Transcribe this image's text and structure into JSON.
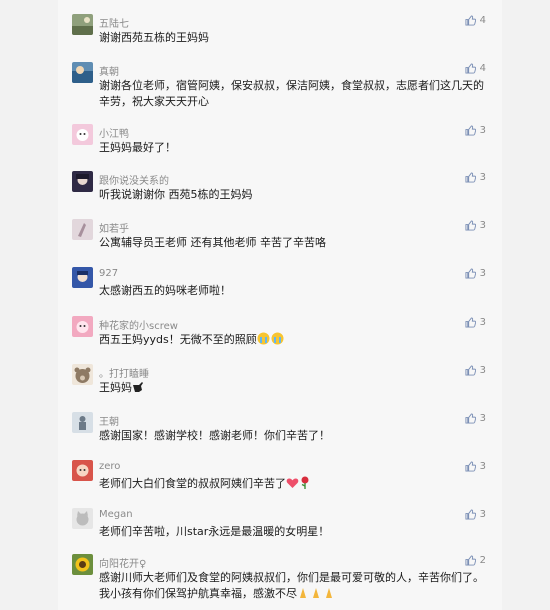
{
  "comments": [
    {
      "nick": "五陆七",
      "text": "谢谢西苑五栋的王妈妈",
      "likes": "4",
      "avatar": "avatar-landscape",
      "color": "#6d7b5e"
    },
    {
      "nick": "真朝",
      "text": "谢谢各位老师，宿管阿姨，保安叔叔，保洁阿姨，食堂叔叔，志愿者们这几天的辛劳，祝大家天天开心",
      "likes": "4",
      "avatar": "avatar-photo",
      "color": "#4a7fa8"
    },
    {
      "nick": "小江鸭",
      "text": "王妈妈最好了！",
      "likes": "3",
      "avatar": "avatar-pink",
      "color": "#e9a7c7"
    },
    {
      "nick": "跟你说没关系的",
      "text": "听我说谢谢你 西苑5栋的王妈妈",
      "likes": "3",
      "avatar": "avatar-anime",
      "color": "#3c3650"
    },
    {
      "nick": "如若乎",
      "text": "公寓辅导员王老师   还有其他老师   辛苦了辛苦咯",
      "likes": "3",
      "avatar": "avatar-sketch",
      "color": "#cbbcc4"
    },
    {
      "nick": "927",
      "text": "太感谢西五的妈咪老师啦！",
      "likes": "3",
      "avatar": "avatar-blue",
      "color": "#3f5fb0"
    },
    {
      "nick": "种花家的小screw",
      "text": "西五王妈yyds！无微不至的照顾",
      "likes": "3",
      "avatar": "avatar-cartoon",
      "color": "#e887a6"
    },
    {
      "nick": "。打打瞌睡",
      "text": "王妈妈",
      "likes": "3",
      "avatar": "avatar-bear",
      "color": "#9a8a78"
    },
    {
      "nick": "王朝",
      "text": "感谢国家！感谢学校！感谢老师！你们辛苦了！",
      "likes": "3",
      "avatar": "avatar-figure",
      "color": "#b9c7d4"
    },
    {
      "nick": "zero",
      "text": "老师们大白们食堂的叔叔阿姨们辛苦了",
      "likes": "3",
      "avatar": "avatar-red",
      "color": "#d8544a"
    },
    {
      "nick": "Megan",
      "text": "老师们辛苦啦，川star永远是最温暖的女明星！",
      "likes": "3",
      "avatar": "avatar-cat",
      "color": "#c9c9c9"
    },
    {
      "nick": "向阳花开♀",
      "text": "感谢川师大老师们及食堂的阿姨叔叔们，你们是最可爱可敬的人，辛苦你们了。我小孩有你们保驾护航真幸福，感激不尽",
      "likes": "2",
      "avatar": "avatar-sunflower",
      "color": "#d9a21a"
    }
  ]
}
